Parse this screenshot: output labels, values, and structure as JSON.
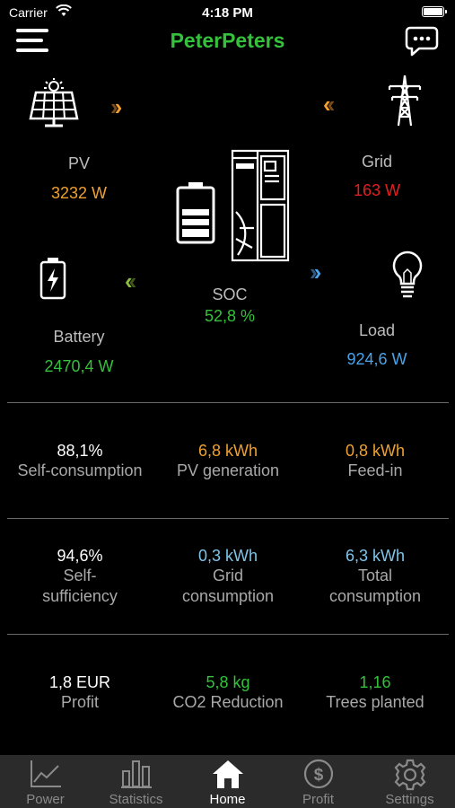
{
  "status_bar": {
    "carrier": "Carrier",
    "time": "4:18 PM"
  },
  "header": {
    "title": "PeterPeters"
  },
  "flow": {
    "pv": {
      "label": "PV",
      "value": "3232 W"
    },
    "grid": {
      "label": "Grid",
      "value": "163 W"
    },
    "battery": {
      "label": "Battery",
      "value": "2470,4 W"
    },
    "soc": {
      "label": "SOC",
      "value": "52,8 %"
    },
    "load": {
      "label": "Load",
      "value": "924,6 W"
    }
  },
  "stats": [
    {
      "value": "88,1%",
      "label": "Self-consumption"
    },
    {
      "value": "6,8 kWh",
      "label": "PV generation"
    },
    {
      "value": "0,8 kWh",
      "label": "Feed-in"
    },
    {
      "value": "94,6%",
      "label": "Self-sufficiency"
    },
    {
      "value": "0,3 kWh",
      "label": "Grid consumption"
    },
    {
      "value": "6,3 kWh",
      "label": "Total consumption"
    },
    {
      "value": "1,8 EUR",
      "label": "Profit"
    },
    {
      "value": "5,8 kg",
      "label": "CO2 Reduction"
    },
    {
      "value": "1,16",
      "label": "Trees planted"
    }
  ],
  "tabs": [
    {
      "label": "Power"
    },
    {
      "label": "Statistics"
    },
    {
      "label": "Home"
    },
    {
      "label": "Profit"
    },
    {
      "label": "Settings"
    }
  ],
  "colors": {
    "title_green": "#34c13b",
    "pv_orange": "#f0a030",
    "grid_red": "#e02020",
    "battery_green": "#34c13b",
    "load_blue": "#4aa3e8",
    "grid_consumption_blue": "#7fc4ea"
  }
}
